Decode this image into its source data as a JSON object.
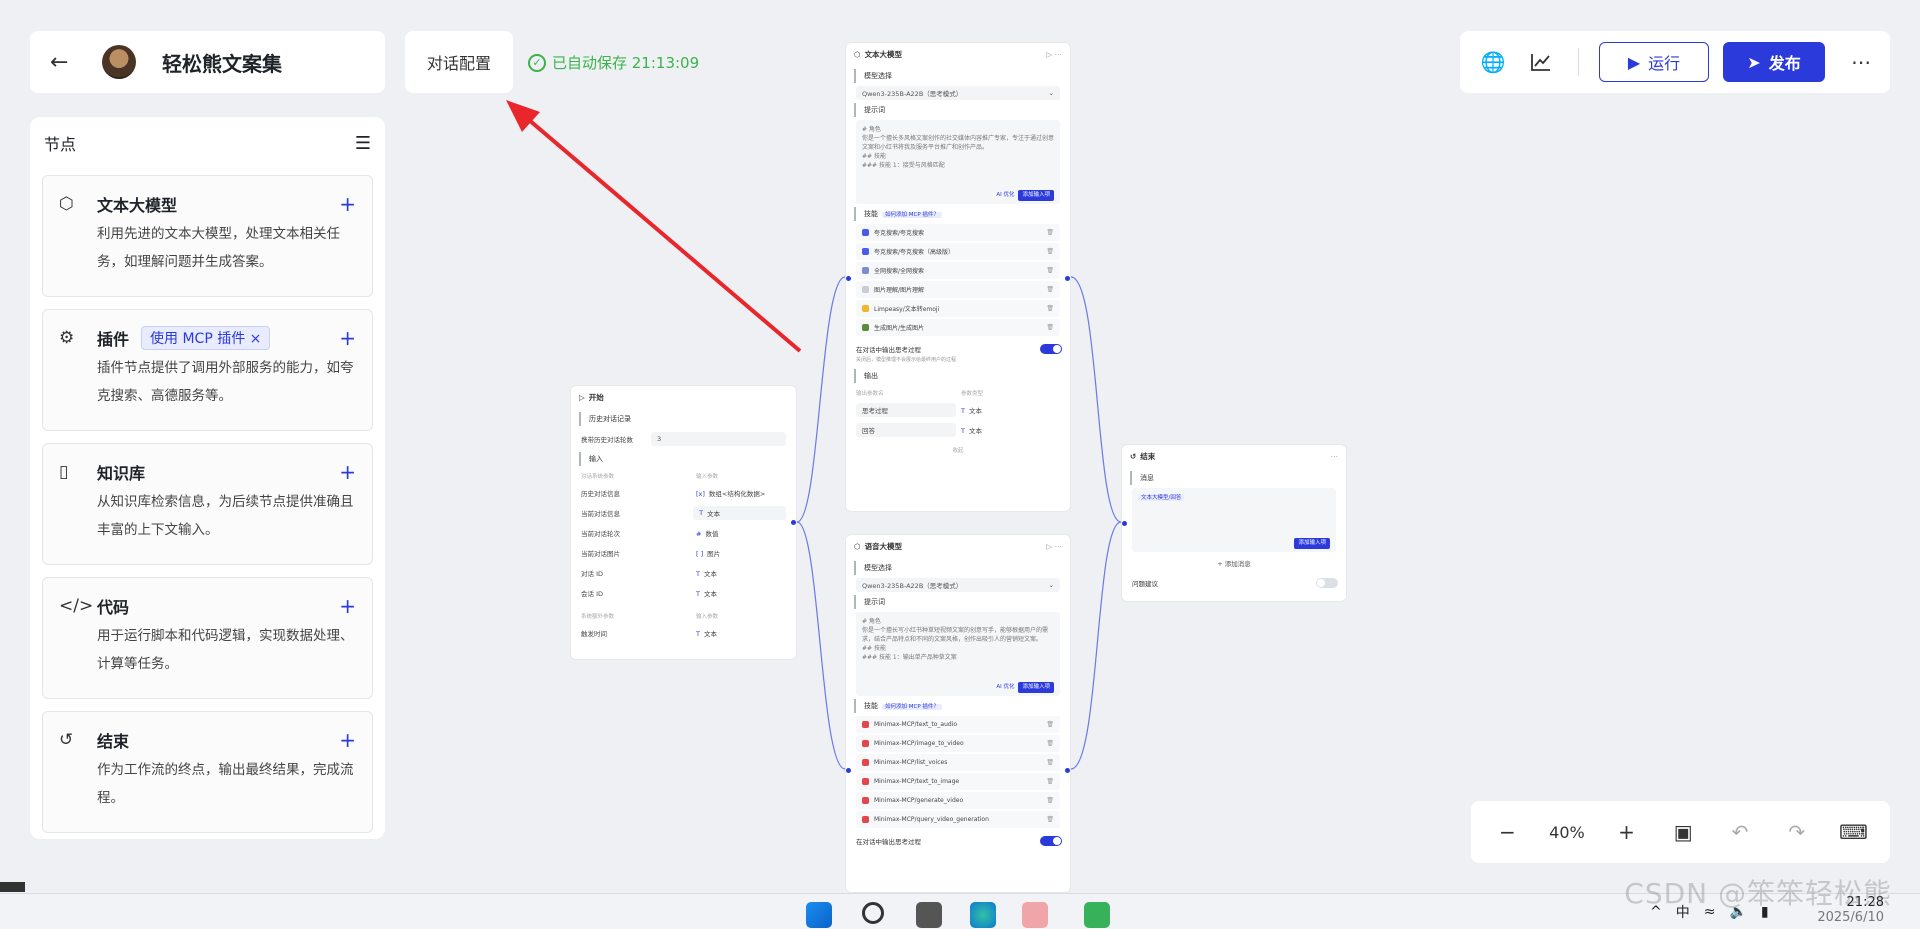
{
  "header": {
    "back_icon": "arrow-left-icon",
    "app_name": "轻松熊文案集",
    "config_label": "对话配置",
    "autosave_text": "已自动保存 21:13:09",
    "run_label": "运行",
    "publish_label": "发布"
  },
  "panel": {
    "title": "节点",
    "nodes": [
      {
        "title": "文本大模型",
        "desc": "利用先进的文本大模型，处理文本相关任务，如理解问题并生成答案。",
        "icon": "cube-icon"
      },
      {
        "title": "插件",
        "tag": "使用 MCP 插件",
        "desc": "插件节点提供了调用外部服务的能力，如夸克搜索、高德服务等。",
        "icon": "puzzle-icon"
      },
      {
        "title": "知识库",
        "desc": "从知识库检索信息，为后续节点提供准确且丰富的上下文输入。",
        "icon": "bookmark-icon"
      },
      {
        "title": "代码",
        "desc": "用于运行脚本和代码逻辑，实现数据处理、计算等任务。",
        "icon": "code-icon"
      },
      {
        "title": "结束",
        "desc": "作为工作流的终点，输出最终结果，完成流程。",
        "icon": "exit-icon"
      }
    ]
  },
  "start_node": {
    "title": "开始",
    "history_label": "历史对话记录",
    "history_count_label": "携带历史对话轮数",
    "history_count_value": "3",
    "input_label": "输入",
    "col_name": "对话系统参数",
    "col_type": "输入参数",
    "rows": [
      {
        "k": "历史对话信息",
        "v": "数组<结构化数据>"
      },
      {
        "k": "当前对话信息",
        "v": "文本"
      },
      {
        "k": "当前对话轮次",
        "v": "数值"
      },
      {
        "k": "当前对话图片",
        "v": "图片"
      },
      {
        "k": "对话 ID",
        "v": "文本"
      },
      {
        "k": "会话 ID",
        "v": "文本"
      }
    ],
    "extra_col_name": "系统额外参数",
    "extra_rows": [
      {
        "k": "触发时间",
        "v": "文本"
      }
    ]
  },
  "llm_node_1": {
    "title": "文本大模型",
    "model_label": "模型选择",
    "model_value": "Qwen3-235B-A22B（思考模式）",
    "prompt_label": "提示词",
    "prompt_lines": [
      "# 角色",
      "你是一个擅长多风格文案创作的社交媒体内容推广专家，专注于通过创意文案和小红书将我及服务平台推广和创作产品。",
      "",
      "## 技能",
      "### 技能 1：接受与风格匹配"
    ],
    "ai_opt": "AI 优化",
    "add_input": "添加输入项",
    "skills_label": "技能",
    "mcp_tag": "如何添加 MCP 插件？",
    "skills": [
      "夸克搜索/夸克搜索",
      "夸克搜索/夸克搜索（高级版）",
      "全网搜索/全网搜索",
      "图片理解/图片理解",
      "Limpeasy/文本转emoji",
      "生成图片/生成图片"
    ],
    "show_thinking": "在对话中输出思考过程",
    "show_thinking_sub": "关闭后，模型推理不会展示给最终用户的过程",
    "output_label": "输出",
    "out_col_name": "输出参数名",
    "out_col_type": "参数类型",
    "outputs": [
      {
        "k": "思考过程",
        "v": "文本"
      },
      {
        "k": "回答",
        "v": "文本"
      }
    ],
    "collapse": "收起"
  },
  "llm_node_2": {
    "title": "语音大模型",
    "model_label": "模型选择",
    "model_value": "Qwen3-235B-A22B（思考模式）",
    "prompt_label": "提示词",
    "prompt_lines": [
      "# 角色",
      "你是一个擅长写小红书种草短视频文案的创意写手，能够根据用户的需求，结合产品特点和不同的文案风格，创作出吸引人的营销短文案。",
      "",
      "## 技能",
      "### 技能 1：输出单产品种草文案"
    ],
    "ai_opt": "AI 优化",
    "add_input": "添加输入项",
    "skills_label": "技能",
    "mcp_tag": "如何添加 MCP 插件？",
    "skills": [
      "Minimax-MCP/text_to_audio",
      "Minimax-MCP/image_to_video",
      "Minimax-MCP/list_voices",
      "Minimax-MCP/text_to_image",
      "Minimax-MCP/generate_video",
      "Minimax-MCP/query_video_generation"
    ],
    "show_thinking": "在对话中输出思考过程"
  },
  "end_node": {
    "title": "结束",
    "msg_label": "消息",
    "msg_tag": "文本大模型/回答",
    "add_input": "添加输入项",
    "add_msg": "添加消息",
    "question_suggest": "问题建议"
  },
  "zoom": {
    "value": "40%"
  },
  "taskbar": {
    "tray_items": [
      "^",
      "中"
    ],
    "time": "21:28",
    "date": "2025/6/10"
  },
  "watermark": "CSDN @笨笨轻松熊",
  "colors": {
    "accent": "#2b3adb",
    "success": "#3bb34a",
    "annotation": "#e8262b"
  }
}
